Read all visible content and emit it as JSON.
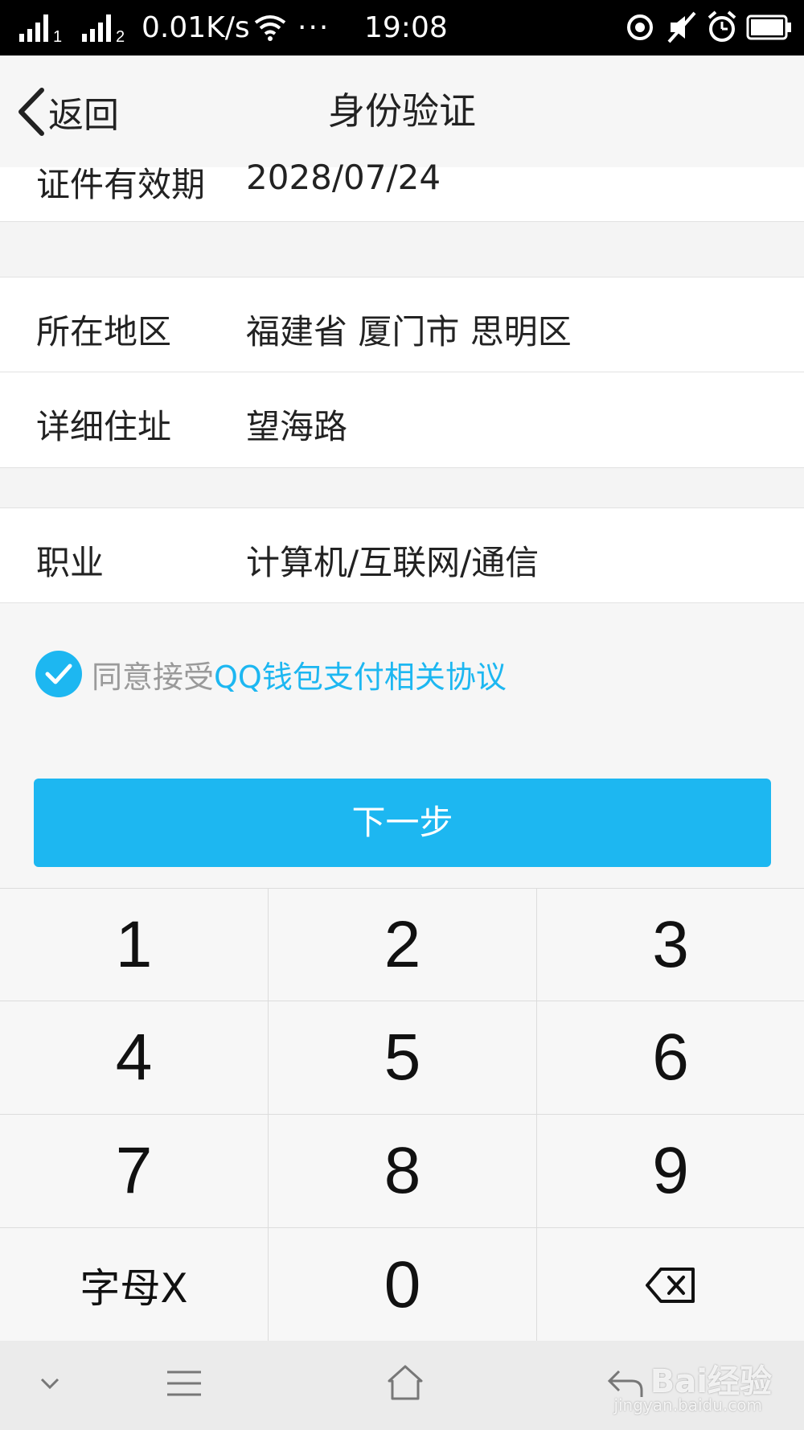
{
  "status_bar": {
    "sim1": "1",
    "sim2": "2",
    "net_speed": "0.01K/s",
    "dots": "···",
    "time": "19:08"
  },
  "header": {
    "back_label": "返回",
    "title": "身份验证"
  },
  "form": {
    "expiry": {
      "label": "证件有效期",
      "value": "2028/07/24"
    },
    "region": {
      "label": "所在地区",
      "value": "福建省 厦门市 思明区"
    },
    "address": {
      "label": "详细住址",
      "value": "望海路"
    },
    "occupation": {
      "label": "职业",
      "value": "计算机/互联网/通信"
    }
  },
  "agreement": {
    "checked": true,
    "prefix": "同意接受",
    "link": "QQ钱包支付相关协议"
  },
  "next_button": "下一步",
  "keypad": {
    "keys": [
      "1",
      "2",
      "3",
      "4",
      "5",
      "6",
      "7",
      "8",
      "9",
      "字母X",
      "0"
    ],
    "backspace_icon": "backspace-icon"
  },
  "navbar": {
    "icons": [
      "chevron-down-icon",
      "menu-icon",
      "home-icon",
      "back-icon"
    ]
  },
  "watermark": {
    "brand": "Bai经验",
    "url": "jingyan.baidu.com"
  },
  "colors": {
    "accent": "#1db7f1",
    "background": "#f6f6f6"
  }
}
